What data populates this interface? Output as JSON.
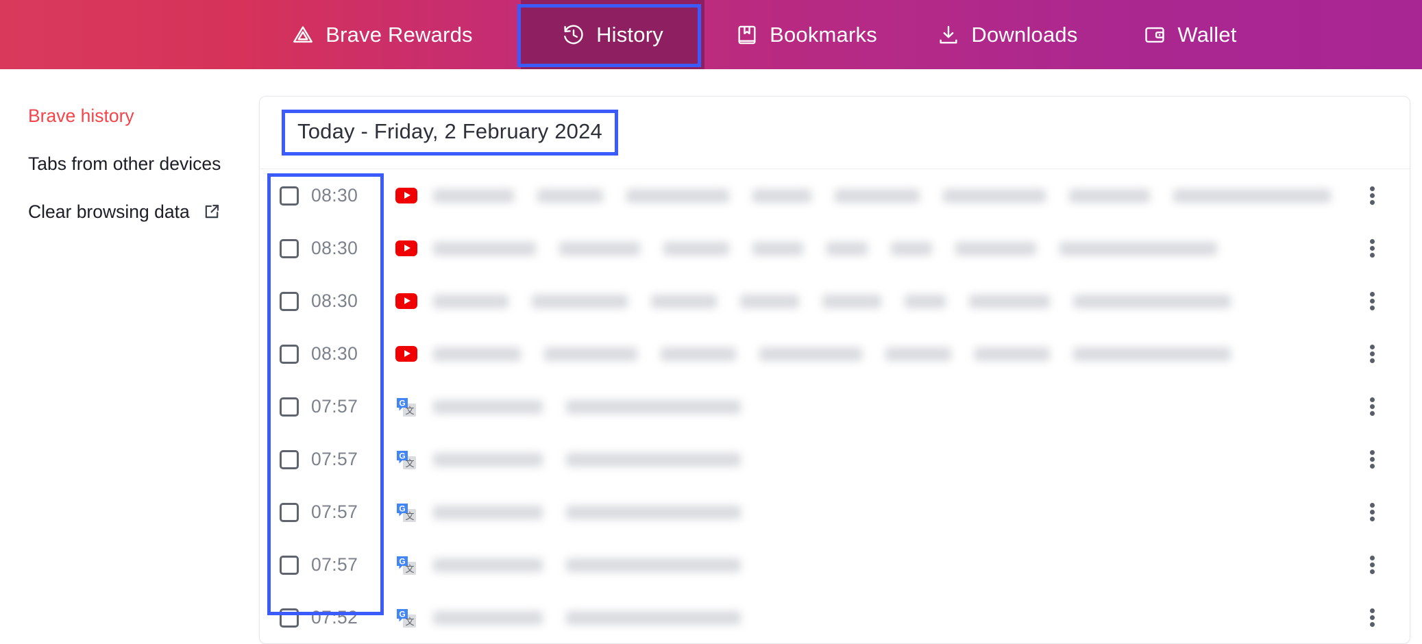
{
  "window": {
    "title": "Brave History"
  },
  "topbar": {
    "gradient_from": "#d93a5c",
    "gradient_to": "#a82694",
    "selected_tab_bg": "#8e2062",
    "highlight_color": "#3b5bfd",
    "tabs": [
      {
        "id": "brave-rewards",
        "label": "Brave Rewards",
        "icon": "brave-triangle-icon",
        "selected": false
      },
      {
        "id": "history",
        "label": "History",
        "icon": "history-clock-icon",
        "selected": true
      },
      {
        "id": "bookmarks",
        "label": "Bookmarks",
        "icon": "bookmark-book-icon",
        "selected": false
      },
      {
        "id": "downloads",
        "label": "Downloads",
        "icon": "download-arrow-icon",
        "selected": false
      },
      {
        "id": "wallet",
        "label": "Wallet",
        "icon": "wallet-icon",
        "selected": false
      }
    ]
  },
  "sidebar": {
    "active_color": "#f3454a",
    "items": [
      {
        "id": "brave-history",
        "label": "Brave history",
        "active": true,
        "external": false
      },
      {
        "id": "tabs-other-devices",
        "label": "Tabs from other devices",
        "active": false,
        "external": false
      },
      {
        "id": "clear-browsing-data",
        "label": "Clear browsing data",
        "active": false,
        "external": true,
        "icon": "external-link-icon"
      }
    ]
  },
  "main": {
    "date_heading": "Today - Friday, 2 February 2024",
    "rows": [
      {
        "time": "08:30",
        "favicon": "youtube-icon",
        "checked": false
      },
      {
        "time": "08:30",
        "favicon": "youtube-icon",
        "checked": false
      },
      {
        "time": "08:30",
        "favicon": "youtube-icon",
        "checked": false
      },
      {
        "time": "08:30",
        "favicon": "youtube-icon",
        "checked": false
      },
      {
        "time": "07:57",
        "favicon": "google-translate-icon",
        "checked": false
      },
      {
        "time": "07:57",
        "favicon": "google-translate-icon",
        "checked": false
      },
      {
        "time": "07:57",
        "favicon": "google-translate-icon",
        "checked": false
      },
      {
        "time": "07:57",
        "favicon": "google-translate-icon",
        "checked": false
      },
      {
        "time": "07:52",
        "favicon": "google-translate-icon",
        "checked": false
      }
    ],
    "row_menu_icon": "kebab-menu-icon"
  }
}
